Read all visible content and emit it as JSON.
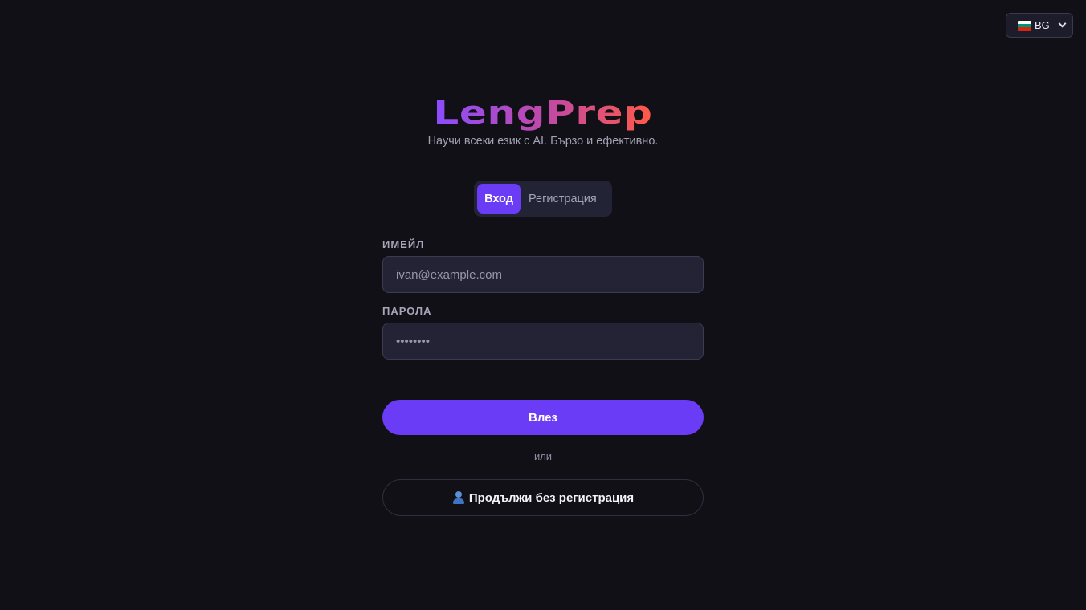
{
  "language_selector": {
    "selected": "BG",
    "flag_colors": [
      "#ffffff",
      "#00966e",
      "#d62612"
    ]
  },
  "brand": {
    "logo_text": "LengPrep",
    "tagline": "Научи всеки език с AI. Бързо и ефективно."
  },
  "tabs": [
    {
      "label": "Вход",
      "active": true
    },
    {
      "label": "Регистрация",
      "active": false
    }
  ],
  "form": {
    "email_label": "ИМЕЙЛ",
    "email_placeholder": "ivan@example.com",
    "password_label": "ПАРОЛА",
    "password_placeholder": "••••••••",
    "submit_label": "Влез"
  },
  "divider_text": "— или —",
  "guest": {
    "label": "Продължи без регистрация",
    "icon": "person-icon"
  },
  "colors": {
    "background": "#111016",
    "accent": "#6a3cf5",
    "input_bg": "#232335"
  }
}
